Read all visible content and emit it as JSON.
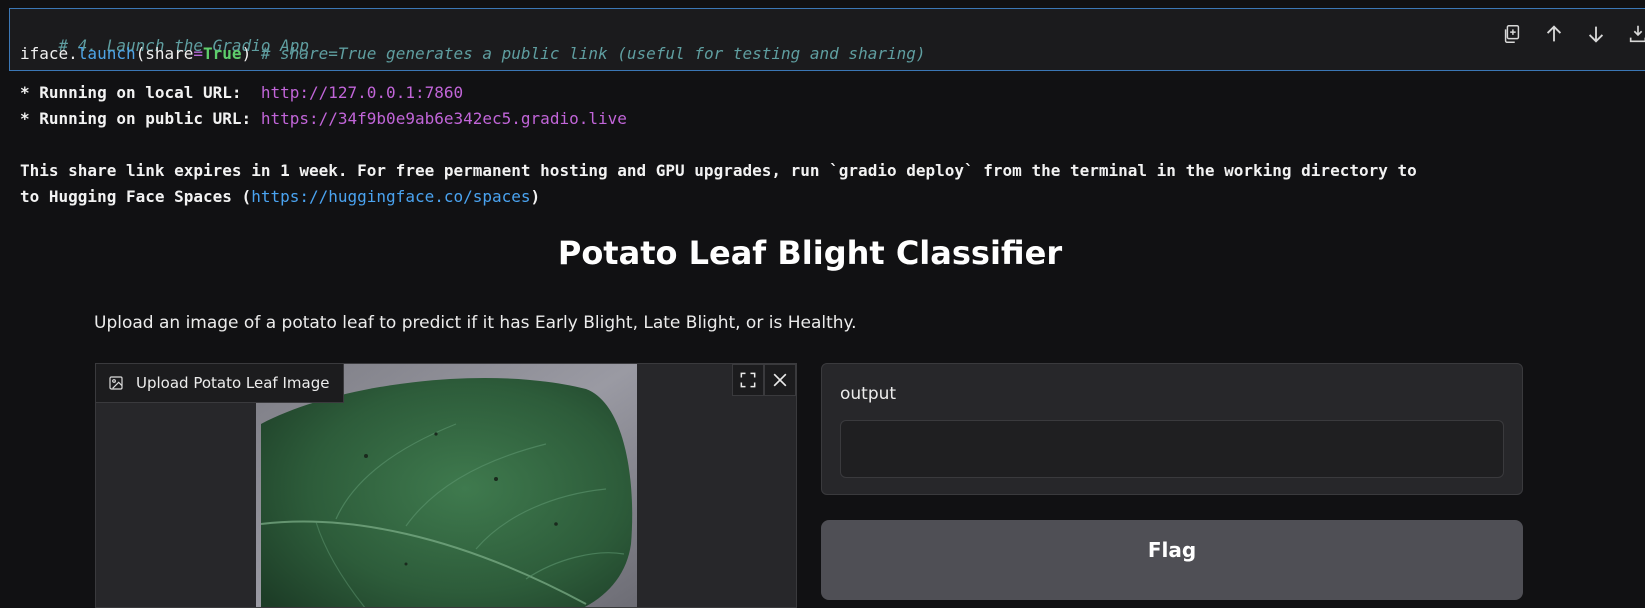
{
  "code": {
    "comment_line": "# 4. Launch the Gradio App",
    "call_object": "iface.",
    "call_method": "launch",
    "call_open": "(share",
    "call_eq": "=",
    "call_value": "True",
    "call_close": ") ",
    "call_comment": "# share=True generates a public link (useful for testing and sharing)"
  },
  "toolbar": {
    "icons": [
      "copy-icon",
      "arrow-up-icon",
      "arrow-down-icon",
      "insert-below-icon"
    ]
  },
  "output": {
    "local_prefix": "* Running on local URL:  ",
    "local_url": "http://127.0.0.1:7860",
    "public_prefix": "* Running on public URL: ",
    "public_url": "https://34f9b0e9ab6e342ec5.gradio.live",
    "share_line1": "This share link expires in 1 week. For free permanent hosting and GPU upgrades, run `gradio deploy` from the terminal in the working directory to",
    "share_line2_prefix": "to Hugging Face Spaces (",
    "share_line2_url": "https://huggingface.co/spaces",
    "share_line2_suffix": ")"
  },
  "app": {
    "title": "Potato Leaf Blight Classifier",
    "description": "Upload an image of a potato leaf to predict if it has Early Blight, Late Blight, or is Healthy.",
    "image_input_label": "Upload Potato Leaf Image",
    "output_label": "output",
    "output_value": "",
    "flag_button": "Flag"
  },
  "colors": {
    "background": "#111113",
    "cell_border": "#3b77b5",
    "link_purple": "#c165d8",
    "link_blue": "#4aa3f0",
    "flag_button_bg": "#4f4f55"
  }
}
